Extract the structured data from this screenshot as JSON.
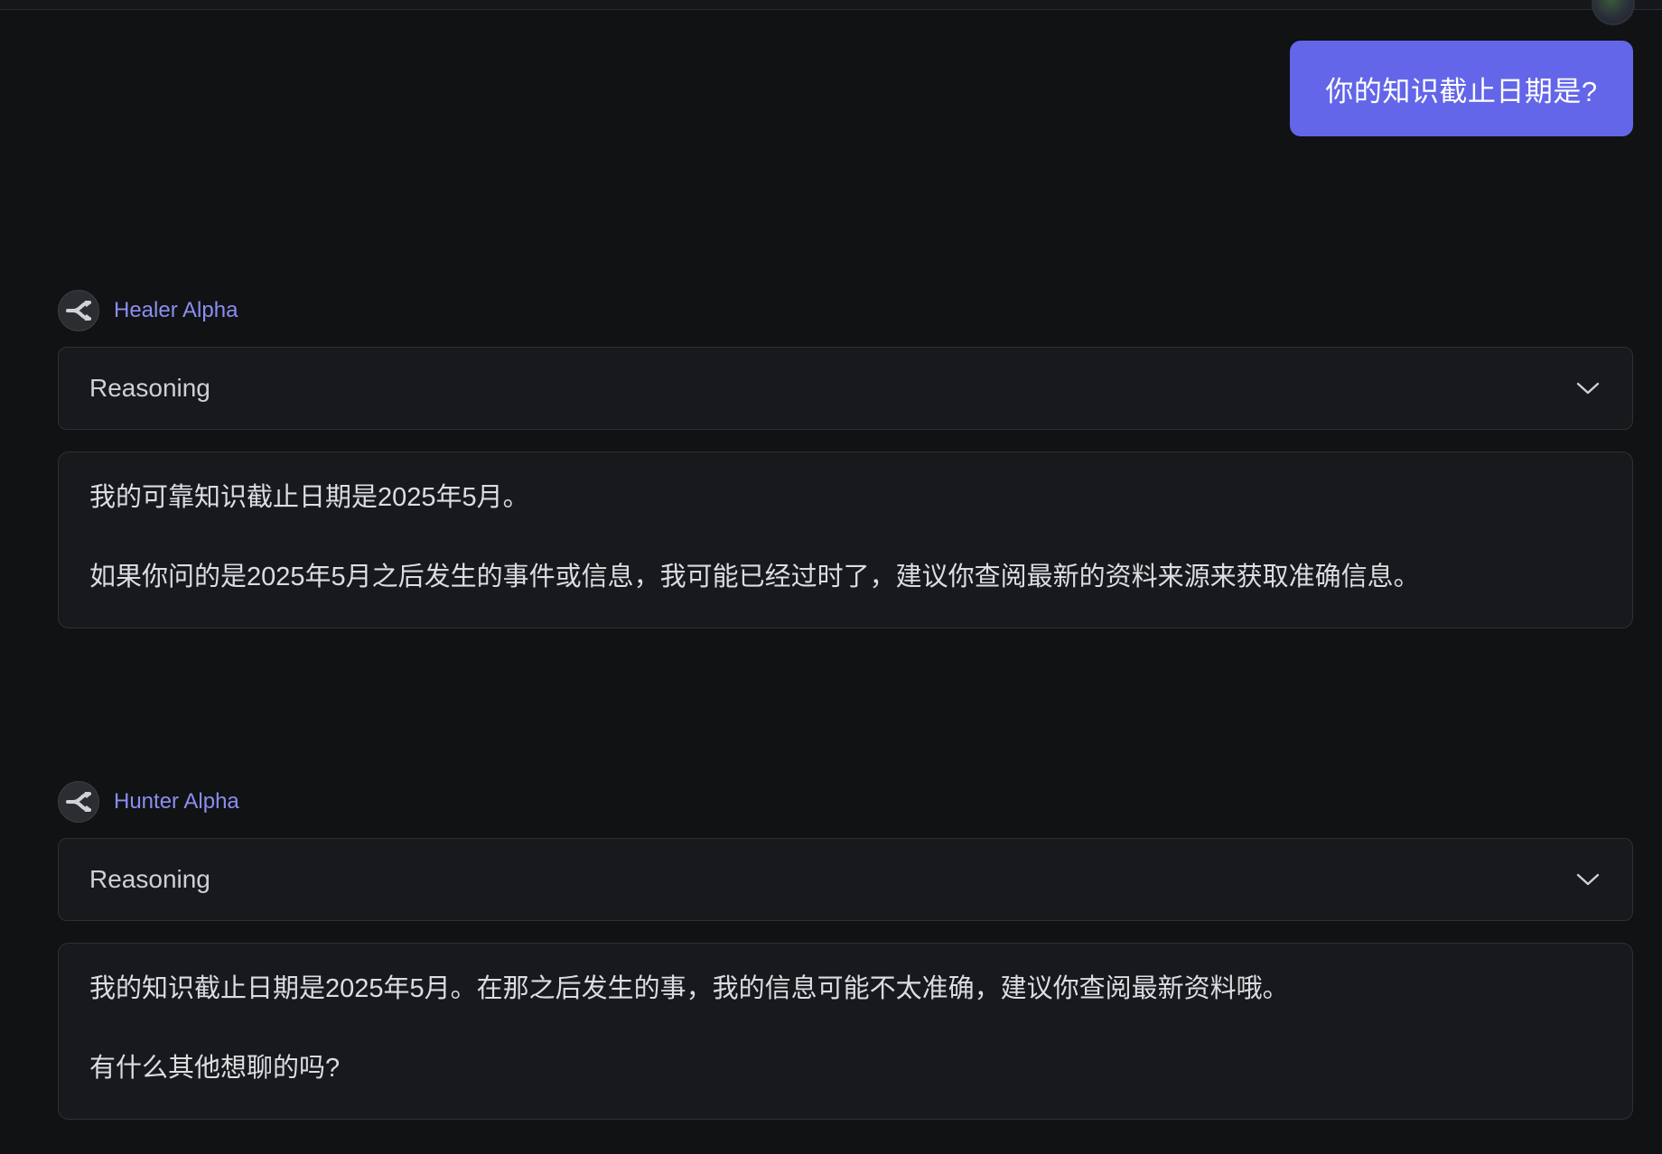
{
  "user_message": {
    "text": "你的知识截止日期是?"
  },
  "responses": [
    {
      "model_name": "Healer Alpha",
      "reasoning_label": "Reasoning",
      "paragraphs": [
        "我的可靠知识截止日期是2025年5月。",
        "如果你问的是2025年5月之后发生的事件或信息，我可能已经过时了，建议你查阅最新的资料来源来获取准确信息。"
      ]
    },
    {
      "model_name": "Hunter Alpha",
      "reasoning_label": "Reasoning",
      "paragraphs": [
        "我的知识截止日期是2025年5月。在那之后发生的事，我的信息可能不太准确，建议你查阅最新资料哦。",
        "有什么其他想聊的吗?"
      ]
    }
  ],
  "colors": {
    "background": "#111214",
    "user_bubble": "#6366e8",
    "model_name": "#8b8ef0",
    "panel": "#18191c"
  },
  "icons": {
    "model_avatar": "openrouter-logo-icon",
    "reasoning_toggle": "chevron-down-icon"
  }
}
